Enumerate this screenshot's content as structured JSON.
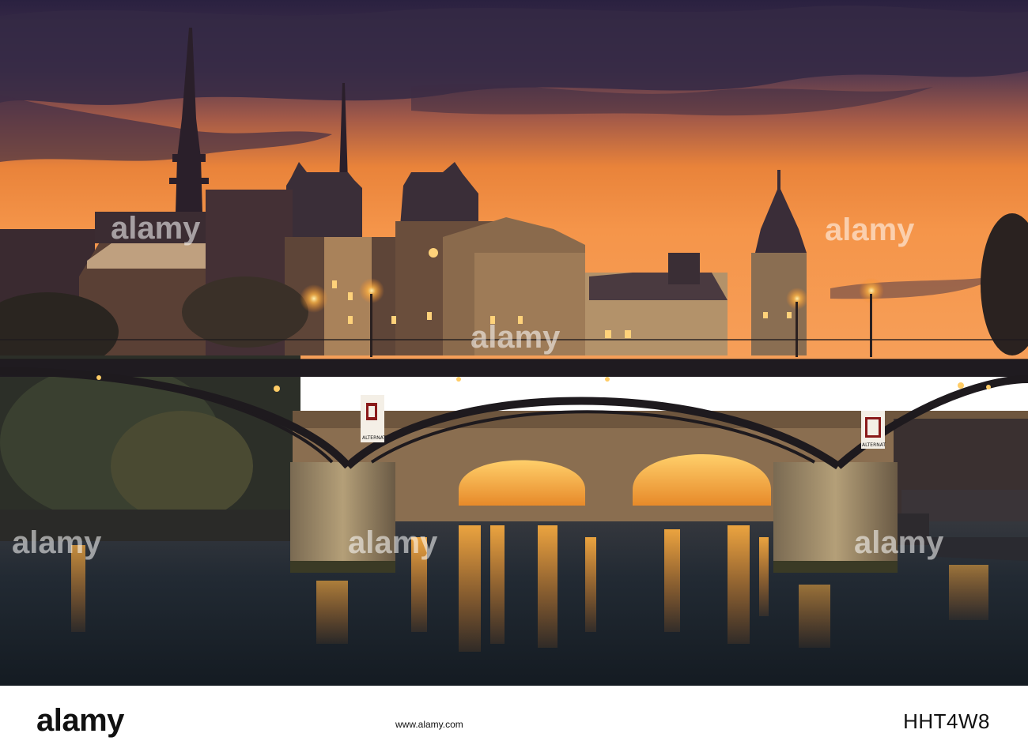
{
  "watermark": {
    "text": "alamy",
    "color": "#ffffff"
  },
  "footer": {
    "logo": "alamy",
    "image_id": "HHT4W8",
    "url": "www.alamy.com",
    "background": "#ffffff"
  },
  "signs": {
    "left_text": "ALTERNAT",
    "right_text": "ALTERNAT"
  },
  "colors": {
    "sky_top": "#2c2240",
    "sky_horizon": "#f08a3a",
    "water": "#1f2a33",
    "lamp_glow": "#ffb545"
  }
}
